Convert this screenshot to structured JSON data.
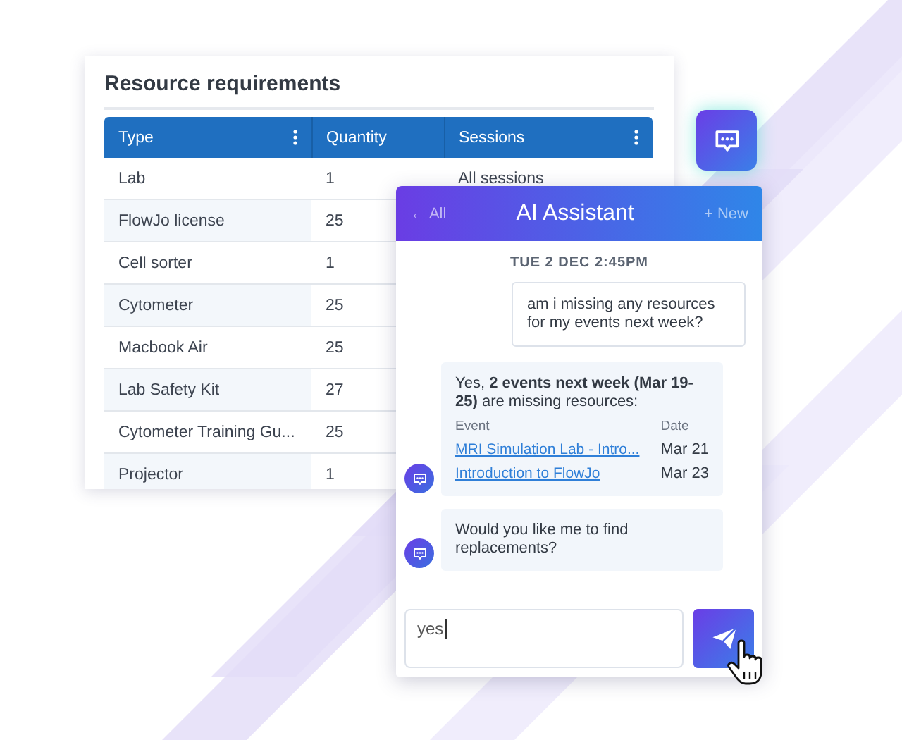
{
  "table_card": {
    "title": "Resource requirements",
    "columns": [
      {
        "label": "Type",
        "menu": true
      },
      {
        "label": "Quantity",
        "menu": false
      },
      {
        "label": "Sessions",
        "menu": true
      }
    ],
    "rows": [
      {
        "cells": [
          "Lab",
          "1",
          "All sessions"
        ]
      },
      {
        "cells": [
          "FlowJo license",
          "25"
        ]
      },
      {
        "cells": [
          "Cell sorter",
          "1"
        ]
      },
      {
        "cells": [
          "Cytometer",
          "25"
        ]
      },
      {
        "cells": [
          "Macbook Air",
          "25"
        ]
      },
      {
        "cells": [
          "Lab Safety Kit",
          "27"
        ]
      },
      {
        "cells": [
          "Cytometer Training Gu...",
          "25"
        ]
      },
      {
        "cells": [
          "Projector",
          "1"
        ]
      }
    ]
  },
  "chat": {
    "back": "← All",
    "title": "AI Assistant",
    "new": "+ New",
    "timestamp": "TUE 2 DEC 2:45PM",
    "messages": [
      {
        "kind": "user",
        "text": "am i missing any resources for my events next week?"
      },
      {
        "kind": "bot",
        "text": "Yes, **2 events next week (Mar 19-25)** are missing resources:",
        "table": {
          "columns": [
            "Event",
            "Date"
          ],
          "rows": [
            {
              "event": "MRI Simulation Lab - Intro...",
              "date": "Mar 21"
            },
            {
              "event": "Introduction to FlowJo",
              "date": "Mar 23"
            }
          ]
        }
      },
      {
        "kind": "bot",
        "text": "Would you like me to find replacements?"
      }
    ],
    "input": {
      "value": "yes"
    }
  }
}
